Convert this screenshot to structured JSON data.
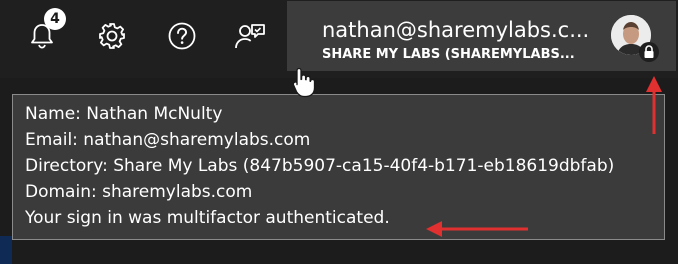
{
  "header": {
    "notifications": {
      "icon": "bell-icon",
      "count": "4"
    },
    "settings": {
      "icon": "gear-icon"
    },
    "help": {
      "icon": "question-mark-icon"
    },
    "feedback": {
      "icon": "feedback-person-icon"
    },
    "account": {
      "email": "nathan@sharemylabs.c...",
      "directory": "SHARE MY LABS (SHAREMYLABS...",
      "avatar": "avatar-photo",
      "lock_icon": "lock-icon"
    }
  },
  "tooltip": {
    "lines": [
      "Name: Nathan McNulty",
      "Email: nathan@sharemylabs.com",
      "Directory: Share My Labs (847b5907-ca15-40f4-b171-eb18619dbfab)",
      "Domain: sharemylabs.com",
      "Your sign in was multifactor authenticated."
    ]
  },
  "annotations": {
    "arrow_color": "#e03030"
  },
  "colors": {
    "topbar": "#1f1f1f",
    "account_bg": "#3c3c3c",
    "tooltip_bg": "#3b3b3b",
    "tooltip_border": "#8a8a8a"
  }
}
